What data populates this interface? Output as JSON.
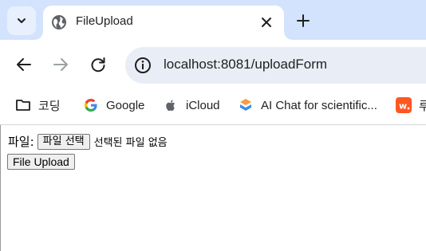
{
  "browser": {
    "tab": {
      "title": "FileUpload"
    },
    "address_bar": {
      "url": "localhost:8081/uploadForm"
    },
    "bookmarks": [
      {
        "label": "코딩",
        "icon": "folder-icon"
      },
      {
        "label": "Google",
        "icon": "google-icon"
      },
      {
        "label": "iCloud",
        "icon": "apple-icon"
      },
      {
        "label": "AI Chat for scientific...",
        "icon": "scispace-icon"
      },
      {
        "label": "루",
        "icon": "wrtn-icon"
      }
    ]
  },
  "page": {
    "file_label": "파일:",
    "choose_file_button": "파일 선택",
    "no_file_text": "선택된 파일 없음",
    "upload_button": "File Upload"
  },
  "colors": {
    "tabstrip_bg": "#d3e3fd",
    "omnibox_bg": "#e9eef6",
    "google_blue": "#4285f4",
    "google_red": "#ea4335",
    "google_yellow": "#fbbc05",
    "google_green": "#34a853",
    "wrtn_orange": "#ff5722"
  }
}
